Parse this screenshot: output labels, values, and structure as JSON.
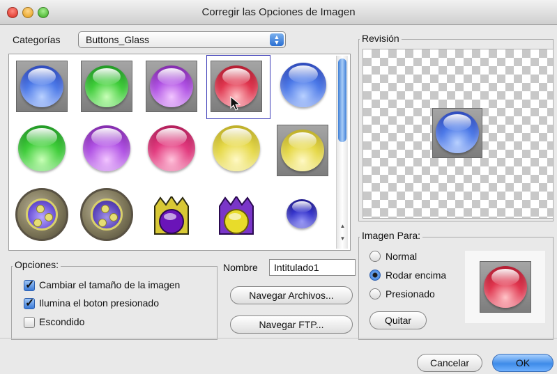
{
  "window": {
    "title": "Corregir las Opciones de Imagen"
  },
  "categories": {
    "label": "Categorías",
    "selected": "Buttons_Glass"
  },
  "preview": {
    "legend": "Revisión"
  },
  "options": {
    "legend": "Opciones:",
    "items": [
      {
        "label": "Cambiar el tamaño de la imagen",
        "checked": true
      },
      {
        "label": "Ilumina el boton presionado",
        "checked": true
      },
      {
        "label": "Escondido",
        "checked": false
      }
    ]
  },
  "nombre": {
    "label": "Nombre",
    "value": "Intitulado1"
  },
  "buttons": {
    "browse_files": "Navegar Archivos...",
    "browse_ftp": "Navegar FTP...",
    "remove": "Quitar",
    "cancel": "Cancelar",
    "ok": "OK"
  },
  "image_for": {
    "legend": "Imagen Para:",
    "options": [
      "Normal",
      "Rodar encima",
      "Presionado"
    ],
    "selected": "Rodar encima"
  },
  "gallery": [
    {
      "icon": "blue-glass-button-square-icon"
    },
    {
      "icon": "green-glass-button-square-icon"
    },
    {
      "icon": "purple-glass-button-square-icon"
    },
    {
      "icon": "red-glass-button-square-icon",
      "selected": true
    },
    {
      "icon": "blue-glass-orb-icon"
    },
    {
      "icon": "green-glass-orb-icon"
    },
    {
      "icon": "purple-glass-orb-icon"
    },
    {
      "icon": "pink-glass-orb-icon"
    },
    {
      "icon": "yellow-glass-orb-icon"
    },
    {
      "icon": "yellow-glass-button-square-icon"
    },
    {
      "icon": "ornate-gold-button-icon"
    },
    {
      "icon": "ornate-gold-button-pressed-icon"
    },
    {
      "icon": "purple-crown-orb-icon"
    },
    {
      "icon": "yellow-crown-orb-icon"
    },
    {
      "icon": "navy-small-orb-icon"
    }
  ]
}
